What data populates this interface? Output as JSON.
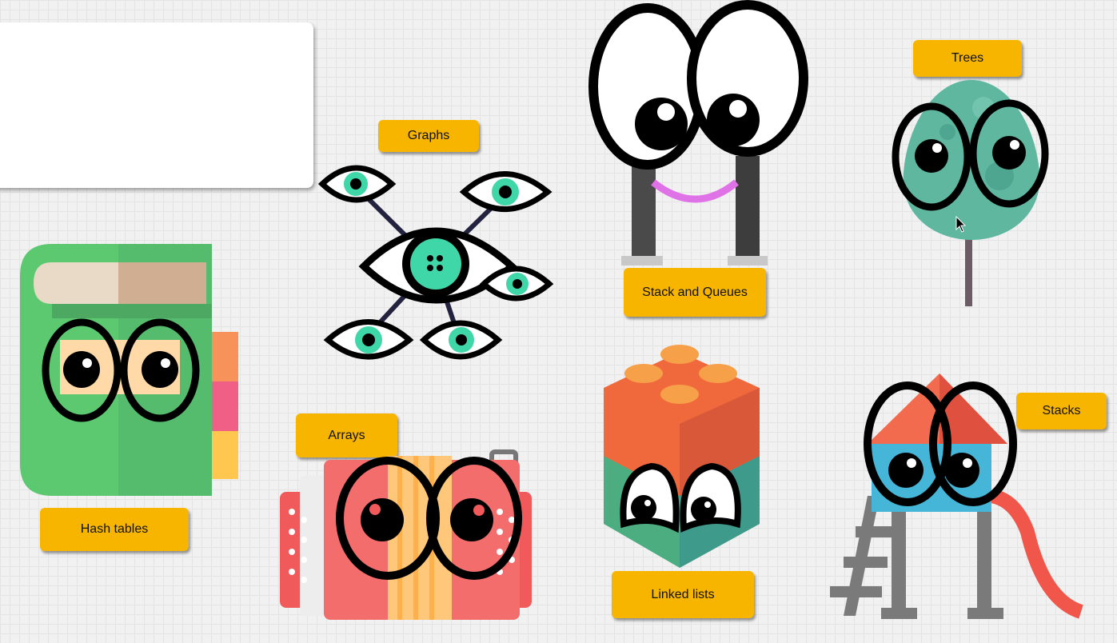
{
  "labels": {
    "graphs": "Graphs",
    "stack_and_queues": "Stack and Queues",
    "trees": "Trees",
    "hash_tables": "Hash tables",
    "arrays": "Arrays",
    "linked_lists": "Linked lists",
    "stacks": "Stacks"
  },
  "colors": {
    "label_bg": "#f7b500",
    "eye_teal": "#3fd6a8",
    "book_green": "#5cc870",
    "accordion_red": "#f05a5a",
    "lego_orange": "#f0693c",
    "tree_teal": "#5fb7a0",
    "roof_red": "#f26b4e"
  },
  "icons": [
    "book-illustration",
    "eye-network-illustration",
    "character-illustration",
    "tree-illustration",
    "accordion-illustration",
    "lego-brick-illustration",
    "playground-slide-illustration",
    "mouse-pointer-icon"
  ]
}
